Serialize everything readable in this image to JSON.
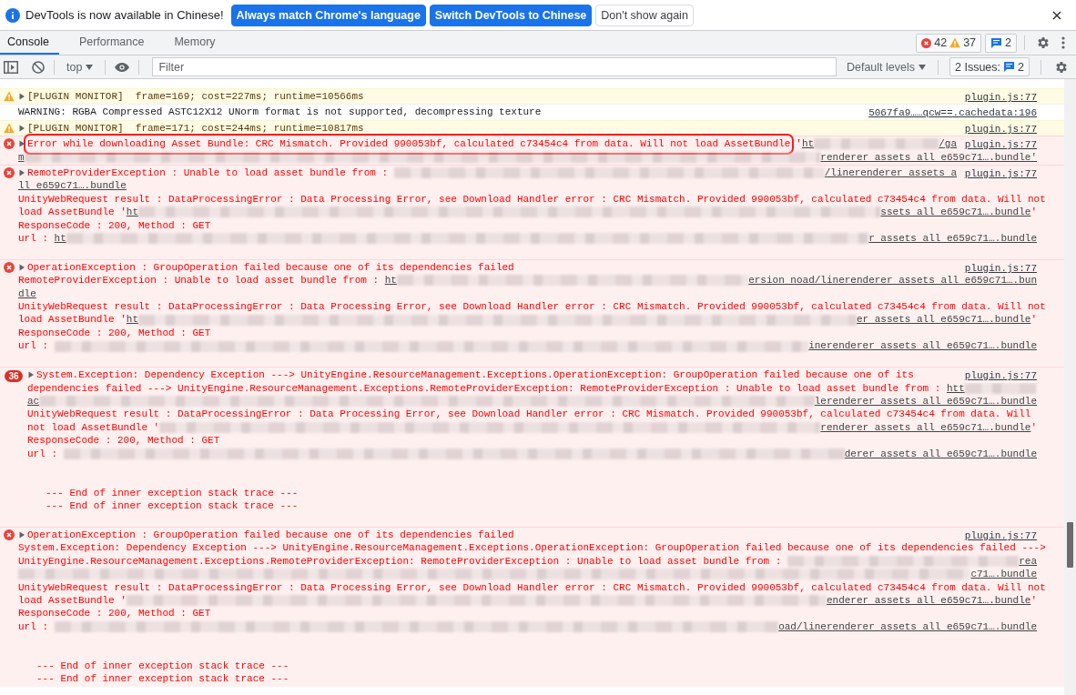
{
  "infobar": {
    "message": "DevTools is now available in Chinese!",
    "buttons": [
      {
        "label": "Always match Chrome's language",
        "kind": "primary"
      },
      {
        "label": "Switch DevTools to Chinese",
        "kind": "primary"
      },
      {
        "label": "Don't show again",
        "kind": "secondary"
      }
    ]
  },
  "tabs": [
    {
      "label": "Console",
      "selected": true
    },
    {
      "label": "Performance",
      "selected": false
    },
    {
      "label": "Memory",
      "selected": false
    }
  ],
  "counters": {
    "errors": "42",
    "warnings": "37",
    "messages": "2"
  },
  "toolbar": {
    "context": "top",
    "filter_placeholder": "Filter",
    "levels": "Default levels",
    "issues_label": "2 Issues:",
    "issues_count": "2"
  },
  "messages": [
    {
      "kind": "warning",
      "expanded": false,
      "source": "plugin.js:77",
      "lines": [
        {
          "segments": [
            {
              "kind": "text",
              "text": "[PLUGIN MONITOR]  frame=169; cost=227ms; runtime=10566ms"
            }
          ]
        }
      ]
    },
    {
      "kind": "info",
      "source": "5067fa9……qcw==.cachedata:196",
      "lines": [
        {
          "segments": [
            {
              "kind": "text",
              "text": "WARNING: RGBA Compressed ASTC12X12 UNorm format is not supported, decompressing texture"
            }
          ]
        }
      ]
    },
    {
      "kind": "warning",
      "expanded": false,
      "source": "plugin.js:77",
      "lines": [
        {
          "segments": [
            {
              "kind": "text",
              "text": "[PLUGIN MONITOR]  frame=171; cost=244ms; runtime=10817ms"
            }
          ]
        }
      ]
    },
    {
      "kind": "error",
      "expanded": false,
      "highlighted": true,
      "source": "plugin.js:77",
      "lines": [
        {
          "segments": [
            {
              "kind": "text",
              "text": "Error while downloading Asset Bundle: CRC Mismatch. Provided 990053bf, calculated c73454c4 from data. Will not load AssetBundle"
            },
            {
              "kind": "text",
              "text": "'"
            },
            {
              "kind": "link",
              "text": "ht"
            },
            {
              "kind": "blur"
            },
            {
              "kind": "link",
              "text": "/ga"
            }
          ]
        },
        {
          "segments": [
            {
              "kind": "link",
              "text": "m"
            },
            {
              "kind": "blur"
            },
            {
              "kind": "link",
              "text": "renderer assets all e659c71….bundle'"
            }
          ]
        }
      ]
    },
    {
      "kind": "error",
      "expanded": false,
      "source": "plugin.js:77",
      "lines": [
        {
          "segments": [
            {
              "kind": "text",
              "text": "RemoteProviderException : Unable to load asset bundle from : "
            },
            {
              "kind": "blur"
            },
            {
              "kind": "link",
              "text": "/linerenderer assets a"
            }
          ]
        },
        {
          "segments": [
            {
              "kind": "link",
              "text": "ll e659c71….bundle"
            }
          ]
        },
        {
          "segments": [
            {
              "kind": "text",
              "text": "UnityWebRequest result : DataProcessingError : Data Processing Error, see Download Handler error : CRC Mismatch. Provided 990053bf, calculated c73454c4 from data. Will not"
            }
          ]
        },
        {
          "segments": [
            {
              "kind": "text",
              "text": "load AssetBundle '"
            },
            {
              "kind": "link",
              "text": "ht"
            },
            {
              "kind": "blur"
            },
            {
              "kind": "link",
              "text": "ssets all e659c71….bundle"
            },
            {
              "kind": "text",
              "text": "'"
            }
          ]
        },
        {
          "segments": [
            {
              "kind": "text",
              "text": "ResponseCode : 200, Method : GET"
            }
          ]
        },
        {
          "segments": [
            {
              "kind": "text",
              "text": "url : "
            },
            {
              "kind": "link",
              "text": "ht"
            },
            {
              "kind": "blur"
            },
            {
              "kind": "link",
              "text": "r assets all e659c71….bundle"
            }
          ]
        },
        {
          "kind": "blank"
        }
      ]
    },
    {
      "kind": "error",
      "expanded": false,
      "source": "plugin.js:77",
      "lines": [
        {
          "segments": [
            {
              "kind": "text",
              "text": "OperationException : GroupOperation failed because one of its dependencies failed"
            }
          ]
        },
        {
          "segments": [
            {
              "kind": "text",
              "text": "RemoteProviderException : Unable to load asset bundle from : "
            },
            {
              "kind": "link",
              "text": "ht"
            },
            {
              "kind": "blur"
            },
            {
              "kind": "link",
              "text": "ersion noad/linerenderer assets all e659c71….bun"
            }
          ]
        },
        {
          "segments": [
            {
              "kind": "link",
              "text": "dle"
            }
          ]
        },
        {
          "segments": [
            {
              "kind": "text",
              "text": "UnityWebRequest result : DataProcessingError : Data Processing Error, see Download Handler error : CRC Mismatch. Provided 990053bf, calculated c73454c4 from data. Will not"
            }
          ]
        },
        {
          "segments": [
            {
              "kind": "text",
              "text": "load AssetBundle '"
            },
            {
              "kind": "link",
              "text": "ht"
            },
            {
              "kind": "blur"
            },
            {
              "kind": "link",
              "text": "er assets all e659c71….bundle"
            },
            {
              "kind": "text",
              "text": "'"
            }
          ]
        },
        {
          "segments": [
            {
              "kind": "text",
              "text": "ResponseCode : 200, Method : GET"
            }
          ]
        },
        {
          "segments": [
            {
              "kind": "text",
              "text": "url : "
            },
            {
              "kind": "blur"
            },
            {
              "kind": "link",
              "text": "inerenderer assets all e659c71….bundle"
            }
          ]
        },
        {
          "kind": "blank"
        }
      ]
    },
    {
      "kind": "error",
      "expanded": false,
      "repeat_count": "36",
      "source": "plugin.js:77",
      "lines": [
        {
          "segments": [
            {
              "kind": "text",
              "text": "System.Exception: Dependency Exception ---> UnityEngine.ResourceManagement.Exceptions.OperationException: GroupOperation failed because one of its"
            }
          ]
        },
        {
          "segments": [
            {
              "kind": "text",
              "text": "dependencies failed ---> UnityEngine.ResourceManagement.Exceptions.RemoteProviderException: RemoteProviderException : Unable to load asset bundle from : "
            },
            {
              "kind": "link",
              "text": "htt"
            },
            {
              "kind": "blur"
            }
          ]
        },
        {
          "segments": [
            {
              "kind": "link",
              "text": "ac"
            },
            {
              "kind": "blur"
            },
            {
              "kind": "link",
              "text": "lerenderer assets all e659c71….bundle"
            }
          ]
        },
        {
          "segments": [
            {
              "kind": "text",
              "text": "UnityWebRequest result : DataProcessingError : Data Processing Error, see Download Handler error : CRC Mismatch. Provided 990053bf, calculated c73454c4 from data. Will"
            }
          ]
        },
        {
          "segments": [
            {
              "kind": "text",
              "text": "not load AssetBundle '"
            },
            {
              "kind": "blur"
            },
            {
              "kind": "link",
              "text": "renderer assets all e659c71….bundle"
            },
            {
              "kind": "text",
              "text": "'"
            }
          ]
        },
        {
          "segments": [
            {
              "kind": "text",
              "text": "ResponseCode : 200, Method : GET"
            }
          ]
        },
        {
          "segments": [
            {
              "kind": "text",
              "text": "url : "
            },
            {
              "kind": "blur"
            },
            {
              "kind": "link",
              "text": "derer assets all e659c71….bundle"
            }
          ]
        },
        {
          "kind": "blank"
        },
        {
          "kind": "blank"
        },
        {
          "kind": "trace",
          "segments": [
            {
              "kind": "text",
              "text": "--- End of inner exception stack trace ---"
            }
          ]
        },
        {
          "kind": "trace",
          "segments": [
            {
              "kind": "text",
              "text": "--- End of inner exception stack trace ---"
            }
          ]
        },
        {
          "kind": "blank"
        }
      ]
    },
    {
      "kind": "error",
      "expanded": false,
      "source": "plugin.js:77",
      "lines": [
        {
          "segments": [
            {
              "kind": "text",
              "text": "OperationException : GroupOperation failed because one of its dependencies failed"
            }
          ]
        },
        {
          "segments": [
            {
              "kind": "text",
              "text": "System.Exception: Dependency Exception ---> UnityEngine.ResourceManagement.Exceptions.OperationException: GroupOperation failed because one of its dependencies failed --->"
            }
          ]
        },
        {
          "segments": [
            {
              "kind": "text",
              "text": "UnityEngine.ResourceManagement.Exceptions.RemoteProviderException: RemoteProviderException : Unable to load asset bundle from : "
            },
            {
              "kind": "blur"
            },
            {
              "kind": "link",
              "text": "rea"
            }
          ]
        },
        {
          "segments": [
            {
              "kind": "blur"
            },
            {
              "kind": "link",
              "text": "c71….bundle"
            }
          ]
        },
        {
          "segments": [
            {
              "kind": "text",
              "text": "UnityWebRequest result : DataProcessingError : Data Processing Error, see Download Handler error : CRC Mismatch. Provided 990053bf, calculated c73454c4 from data. Will not"
            }
          ]
        },
        {
          "segments": [
            {
              "kind": "text",
              "text": "load AssetBundle '"
            },
            {
              "kind": "blur"
            },
            {
              "kind": "link",
              "text": "enderer assets all e659c71….bundle"
            },
            {
              "kind": "text",
              "text": "'"
            }
          ]
        },
        {
          "segments": [
            {
              "kind": "text",
              "text": "ResponseCode : 200, Method : GET"
            }
          ]
        },
        {
          "segments": [
            {
              "kind": "text",
              "text": "url : "
            },
            {
              "kind": "blur"
            },
            {
              "kind": "link",
              "text": "oad/linerenderer assets all e659c71….bundle"
            }
          ]
        },
        {
          "kind": "blank"
        },
        {
          "kind": "blank"
        },
        {
          "kind": "trace",
          "segments": [
            {
              "kind": "text",
              "text": "--- End of inner exception stack trace ---"
            }
          ]
        },
        {
          "kind": "trace",
          "segments": [
            {
              "kind": "text",
              "text": "--- End of inner exception stack trace ---"
            }
          ]
        }
      ]
    }
  ]
}
